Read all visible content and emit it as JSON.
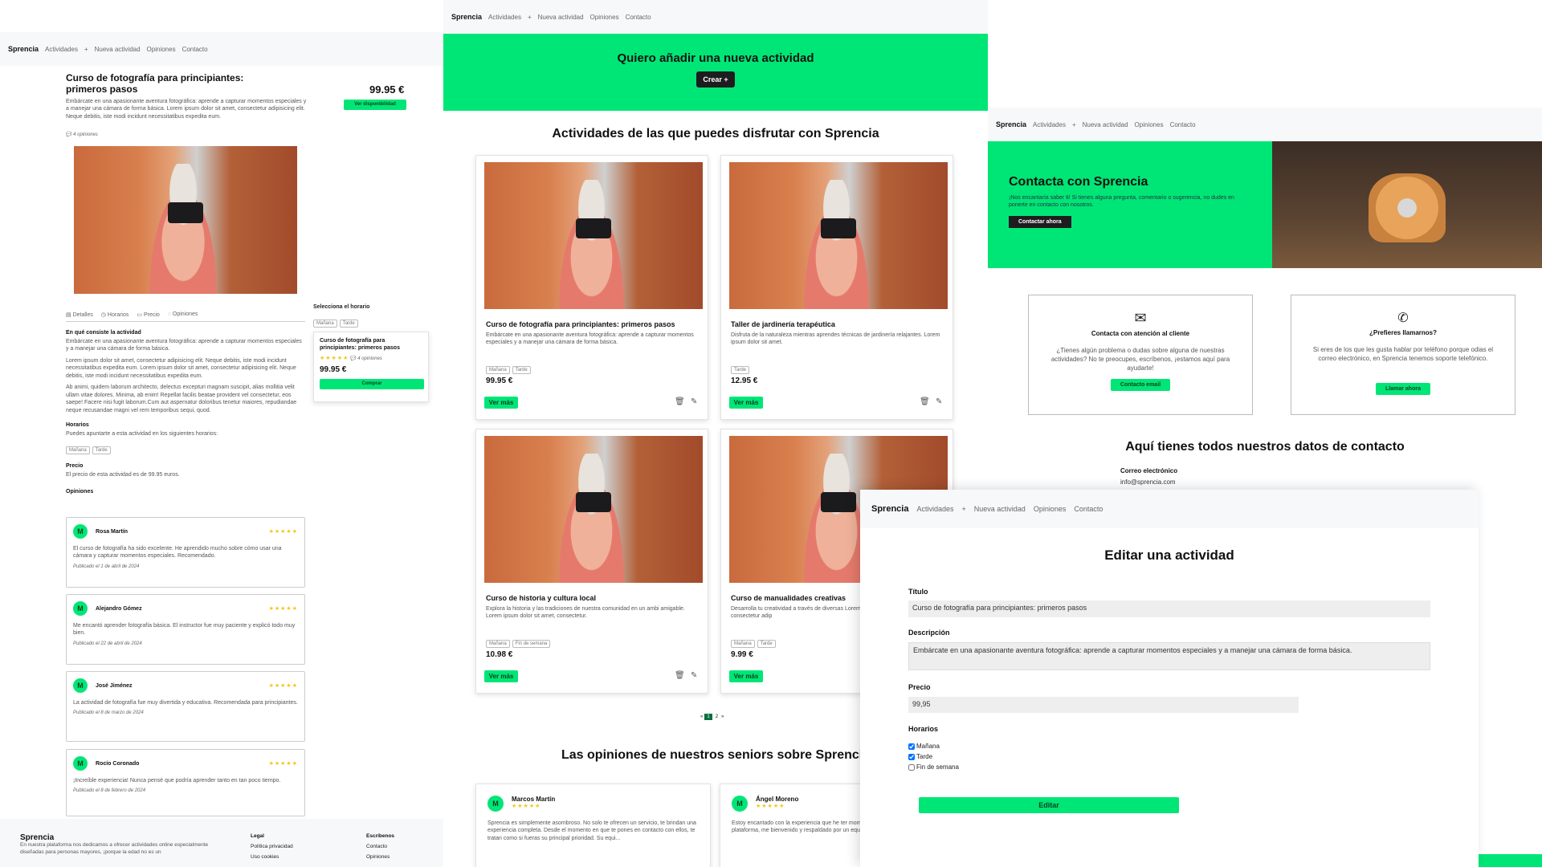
{
  "nav": {
    "brand": "Sprencia",
    "items": [
      "Actividades",
      "Nueva actividad",
      "Opiniones",
      "Contacto"
    ]
  },
  "detail": {
    "title": "Curso de fotografía para principiantes: primeros pasos",
    "price": "99.95 €",
    "availability_button": "Ver disponibilidad",
    "description": "Embárcate en una apasionante aventura fotográfica: aprende a capturar momentos especiales y a manejar una cámara de forma básica. Lorem ipsum dolor sit amet, consectetur adipisicing elit. Neque debitis, iste modi incidunt necessitatibus expedita eum.",
    "reviews_count": "4 opiniones",
    "tabs": [
      "Detalles",
      "Horarios",
      "Precio",
      "Opiniones"
    ],
    "section_what": "En qué consiste la actividad",
    "para1": "Embárcate en una apasionante aventura fotográfica: aprende a capturar momentos especiales y a manejar una cámara de forma básica.",
    "para2": "Lorem ipsum dolor sit amet, consectetur adipisicing elit. Neque debitis, iste modi incidunt necessitatibus expedita eum. Lorem ipsum dolor sit amet, consectetur adipisicing elit. Neque debitis, iste modi incidunt necessitatibus expedita eum.",
    "para3": "Ab animi, quidem laborum architecto, delectus excepturi magnam suscipit, alias mollitia velit ullam vitae dolores. Minima, ab enim! Repellat facilis beatae provident vel consectetur, eos saepe! Facere nisi fugit laborum.Cum aut aspernatur doloribus tenetur maiores, repudiandae neque recusandae magni vel rem temporibus sequi, quod.",
    "schedules_title": "Horarios",
    "schedules_text": "Puedes apuntarte a esta actividad en los siguientes horarios:",
    "schedules": [
      "Mañana",
      "Tarde"
    ],
    "price_title": "Precio",
    "price_text": "El precio de esta actividad es de 99.95 euros.",
    "opinions_title": "Opiniones",
    "select_schedule": "Selecciona el horario",
    "mini_title": "Curso de fotografía para principiantes: primeros pasos",
    "mini_reviews": "4 opiniones",
    "mini_price": "99.95 €",
    "buy": "Comprar",
    "reviews": [
      {
        "initial": "M",
        "name": "Rosa Martín",
        "text": "El curso de fotografía ha sido excelente. He aprendido mucho sobre cómo usar una cámara y capturar momentos especiales. Recomendado.",
        "date": "Publicado el 1 de abril de 2024"
      },
      {
        "initial": "M",
        "name": "Alejandro Gómez",
        "text": "Me encantó aprender fotografía básica. El instructor fue muy paciente y explicó todo muy bien.",
        "date": "Publicado el 22 de abril de 2024"
      },
      {
        "initial": "M",
        "name": "José Jiménez",
        "text": "La actividad de fotografía fue muy divertida y educativa. Recomendada para principiantes.",
        "date": "Publicado el 8 de marzo de 2024"
      },
      {
        "initial": "M",
        "name": "Rocío Coronado",
        "text": "¡Increíble experiencia! Nunca pensé que podría aprender tanto en tan poco tiempo.",
        "date": "Publicado el 8 de febrero de 2024"
      }
    ],
    "footer": {
      "brand": "Sprencia",
      "text": "En nuestra plataforma nos dedicamos a ofrecer actividades online especialmente diseñadas para personas mayores, ¡porque la edad no es un",
      "legal": "Legal",
      "legal_items": [
        "Política privacidad",
        "Uso cookies"
      ],
      "write": "Escríbenos",
      "write_items": [
        "Contacto",
        "Opiniones"
      ]
    }
  },
  "list": {
    "hero_title": "Quiero añadir una nueva actividad",
    "hero_button": "Crear +",
    "section_title": "Actividades de las que puedes disfrutar con Sprencia",
    "cards": [
      {
        "title": "Curso de fotografía para principiantes: primeros pasos",
        "desc": "Embárcate en una apasionante aventura fotográfica: aprende a capturar momentos especiales y a manejar una cámara de forma básica.",
        "tags": [
          "Mañana",
          "Tarde"
        ],
        "price": "99.95 €"
      },
      {
        "title": "Taller de jardinería terapéutica",
        "desc": "Disfruta de la naturaleza mientras aprendes técnicas de jardinería relajantes. Lorem ipsum dolor sit amet.",
        "tags": [
          "Tarde"
        ],
        "price": "12.95 €"
      },
      {
        "title": "Curso de historia y cultura local",
        "desc": "Explora la historia y las tradiciones de nuestra comunidad en un ambi amigable. Lorem ipsum dolor sit amet, consectetur.",
        "tags": [
          "Mañana",
          "Fin de semana"
        ],
        "price": "10.98 €"
      },
      {
        "title": "Curso de manualidades creativas",
        "desc": "Desarrolla tu creatividad a través de diversas Lorem ipsum dolor sit amet, consectetur adip",
        "tags": [
          "Mañana",
          "Tarde"
        ],
        "price": "9.99 €"
      }
    ],
    "see_more": "Ver más",
    "pagination": [
      "«",
      "1",
      "2",
      "»"
    ],
    "opinions_title": "Las opiniones de nuestros seniors sobre Sprenci",
    "opinions": [
      {
        "initial": "M",
        "name": "Marcos Martín",
        "text": "Sprencia es simplemente asombroso. No solo te ofrecen un servicio, te brindan una experiencia completa. Desde el momento en que te pones en contacto con ellos, te tratan como si fueras su principal prioridad. Su equi..."
      },
      {
        "initial": "M",
        "name": "Ángel Moreno",
        "text": "Estoy encantado con la experiencia que he ter momento en que me uní a su plataforma, me bienvenido y respaldado por un equipo alt"
      }
    ]
  },
  "contact": {
    "hero_title": "Contacta con Sprencia",
    "hero_text": "¡Nos encantaría saber ti! Si tienes alguna pregunta, comentario o sugerencia, no dudes en ponerte en contacto con nosotros.",
    "hero_button": "Contactar ahora",
    "box1_title": "Contacta con atención al cliente",
    "box1_text": "¿Tienes algún problema o dudas sobre alguna de nuestras actividades? No te preocupes, escríbenos, ¡estamos aquí para ayudarte!",
    "box1_button": "Contacto email",
    "box2_title": "¿Prefieres llamarnos?",
    "box2_text": "Si eres de los que les gusta hablar por teléfono porque odias el correo electrónico, en Sprencia tenemos soporte telefónico.",
    "box2_button": "Llamar ahora",
    "data_title": "Aquí tienes todos nuestros datos de contacto",
    "email_label": "Correo electrónico",
    "email": "info@sprencia.com"
  },
  "edit": {
    "title": "Editar una actividad",
    "title_label": "Título",
    "title_value": "Curso de fotografía para principiantes: primeros pasos",
    "desc_label": "Descripción",
    "desc_value": "Embárcate en una apasionante aventura fotográfica: aprende a capturar momentos especiales y a manejar una cámara de forma básica.",
    "price_label": "Precio",
    "price_value": "99,95",
    "schedules_label": "Horarios",
    "schedules": [
      {
        "label": "Mañana",
        "checked": true
      },
      {
        "label": "Tarde",
        "checked": true
      },
      {
        "label": "Fin de semana",
        "checked": false
      }
    ],
    "submit": "Editar"
  }
}
